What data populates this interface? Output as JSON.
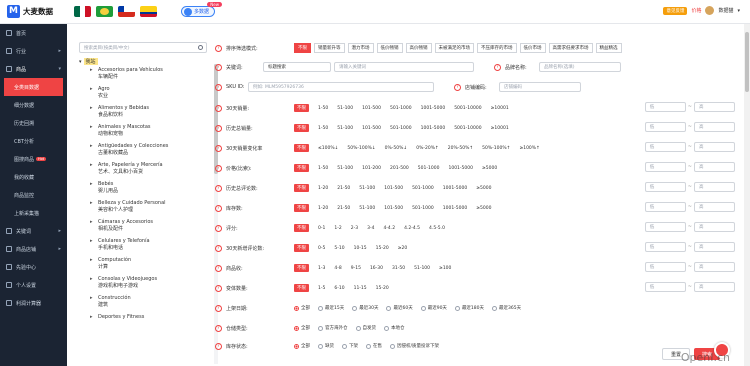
{
  "brand": {
    "name": "大麦数据",
    "mark": "M"
  },
  "header": {
    "ai_label": "多数据",
    "ai_badge": "New",
    "feedback": "意见反馈",
    "pricing": "价格",
    "user": "数据猫",
    "user_caret": "▾",
    "colors": {
      "accent": "#ef4444",
      "sidebar": "#1b2433",
      "brand": "#2563eb"
    }
  },
  "nav": [
    {
      "label": "首页",
      "icon": "home-icon"
    },
    {
      "label": "行业",
      "icon": "industry-icon",
      "chev": "▸"
    },
    {
      "label": "商品",
      "icon": "product-icon",
      "chev": "▾",
      "open": true,
      "subs": [
        {
          "label": "全类目数据",
          "active": true
        },
        {
          "label": "细分数据"
        },
        {
          "label": "历史回溯"
        },
        {
          "label": "CBT分析"
        },
        {
          "label": "图搜商品",
          "hot": "Hot"
        },
        {
          "label": "我的收藏"
        },
        {
          "label": "商品监控"
        },
        {
          "label": "上新采集猫"
        }
      ]
    },
    {
      "label": "关键词",
      "icon": "keyword-icon",
      "chev": "▸"
    },
    {
      "label": "商品店铺",
      "icon": "shop-icon",
      "chev": "▸"
    },
    {
      "label": "先验中心",
      "icon": "center-icon"
    },
    {
      "label": "个人设置",
      "icon": "user-icon"
    },
    {
      "label": "利润计算器",
      "icon": "calc-icon"
    }
  ],
  "categories": {
    "search_placeholder": "搜索类目(按类目/中文)",
    "root": "我站",
    "items": [
      {
        "en": "Accesorios para Vehículos",
        "zh": "车辆配件"
      },
      {
        "en": "Agro",
        "zh": "农业"
      },
      {
        "en": "Alimentos y Bebidas",
        "zh": "食品和饮料"
      },
      {
        "en": "Animales y Mascotas",
        "zh": "动物和宠物"
      },
      {
        "en": "Antigüedades y Colecciones",
        "zh": "古董和收藏品"
      },
      {
        "en": "Arte, Papelería y Mercería",
        "zh": "艺术、文具和小百货"
      },
      {
        "en": "Bebés",
        "zh": "婴儿用品"
      },
      {
        "en": "Belleza y Cuidado Personal",
        "zh": "美容和个人护理"
      },
      {
        "en": "Cámaras y Accesorios",
        "zh": "相机及配件"
      },
      {
        "en": "Celulares y Telefonía",
        "zh": "手机和电话"
      },
      {
        "en": "Computación",
        "zh": "计算"
      },
      {
        "en": "Consolas y Videojuegos",
        "zh": "游戏机和电子游戏"
      },
      {
        "en": "Construcción",
        "zh": "建筑"
      },
      {
        "en": "Deportes y Fitness",
        "zh": ""
      }
    ]
  },
  "filters": {
    "sort": {
      "label": "排序筛选模式:",
      "options": [
        "不限",
        "销量新升等",
        "潜力市场",
        "低价畅销",
        "高价畅销",
        "未被满足的市场",
        "不压库存的市场",
        "低价市场",
        "高需求低要求市场",
        "精益精选"
      ]
    },
    "keyword": {
      "label": "关键词:",
      "select": "标题搜索",
      "input_placeholder": "请输入关键词",
      "brand_label": "品牌名称:",
      "brand_placeholder": "品牌名称(选填)"
    },
    "sku": {
      "label": "SKU ID:",
      "input_placeholder": "例如: MLM5957926736",
      "store_label": "店铺编码:",
      "store_placeholder": "店铺编码"
    },
    "sales30": {
      "label": "30天销量:",
      "options": [
        "不限",
        "1-50",
        "51-100",
        "101-500",
        "501-1000",
        "1001-5000",
        "5001-10000",
        "≥10001"
      ]
    },
    "hist": {
      "label": "历史总销量:",
      "options": [
        "不限",
        "1-50",
        "51-100",
        "101-500",
        "501-1000",
        "1001-5000",
        "5001-10000",
        "≥10001"
      ]
    },
    "growth": {
      "label": "30天销量变化率",
      "options": [
        "不限",
        "≤100%↓",
        "50%-100%↓",
        "0%-50%↓",
        "0%-20%↑",
        "20%-50%↑",
        "50%-100%↑",
        "≥100%↑"
      ]
    },
    "price": {
      "label": "价格(比索):",
      "options": [
        "不限",
        "1-50",
        "51-100",
        "101-200",
        "201-500",
        "501-1000",
        "1001-5000",
        "≥5000"
      ]
    },
    "reviews": {
      "label": "历史总评论数:",
      "options": [
        "不限",
        "1-20",
        "21-50",
        "51-100",
        "101-500",
        "501-1000",
        "1001-5000",
        "≥5000"
      ]
    },
    "stock": {
      "label": "库存数:",
      "options": [
        "不限",
        "1-20",
        "21-50",
        "51-100",
        "101-500",
        "501-1000",
        "1001-5000",
        "≥5000"
      ]
    },
    "rating": {
      "label": "评分:",
      "options": [
        "不限",
        "0-1",
        "1-2",
        "2-3",
        "3-4",
        "4-4.2",
        "4.2-4.5",
        "4.5-5.0"
      ]
    },
    "newreviews": {
      "label": "30天新增评论数:",
      "options": [
        "不限",
        "0-5",
        "5-10",
        "10-15",
        "15-20",
        "≥20"
      ]
    },
    "favs": {
      "label": "商品收:",
      "options": [
        "不限",
        "1-3",
        "4-8",
        "9-15",
        "16-30",
        "31-50",
        "51-100",
        "≥100"
      ]
    },
    "variants": {
      "label": "变体数量:",
      "options": [
        "不限",
        "1-5",
        "6-10",
        "11-15",
        "15-20"
      ]
    },
    "listed": {
      "label": "上架日期:",
      "options": [
        "全部",
        "最近15天",
        "最近30天",
        "最近60天",
        "最近90天",
        "最近180天",
        "最近365天"
      ]
    },
    "warehouse": {
      "label": "仓储类型:",
      "options": [
        "全部",
        "官方海外仓",
        "自发货",
        "本地仓"
      ]
    },
    "stockstate": {
      "label": "库存状态:",
      "options": [
        "全部",
        "缺货",
        "下架",
        "在售",
        "因侵权/质量投诉下架"
      ]
    },
    "range_min": "低",
    "range_max": "高",
    "range_dash": "~"
  },
  "actions": {
    "reset": "重置",
    "search": "搜索"
  },
  "watermark": "OpenI.cn"
}
